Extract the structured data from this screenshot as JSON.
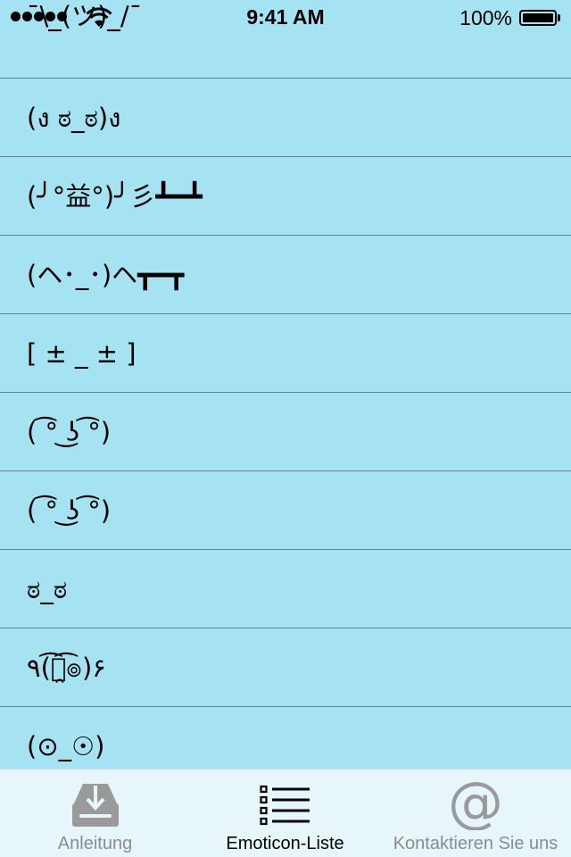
{
  "status_bar": {
    "time": "9:41 AM",
    "battery_percent": "100%",
    "battery_level": 1.0,
    "signal_bars": 5
  },
  "emoticons": [
    "¯\\_(ツ)_/¯",
    "(ง ಠ_ಠ)ง",
    "(╯°益°)╯彡┻━┻",
    "(ヘ･_･)ヘ┳━┳",
    "[ ± _ ± ]",
    "( ͡° ͜ʖ ͡°)",
    "( ͡° ͜ʖ ͡°)",
    "ಠ_ಠ",
    "٩(͡๏̯͡๏)۶",
    "(⊙_☉)"
  ],
  "tab_bar": {
    "tabs": [
      {
        "label": "Anleitung",
        "icon": "download-tray-icon",
        "active": false
      },
      {
        "label": "Emoticon-Liste",
        "icon": "list-icon",
        "active": true
      },
      {
        "label": "Kontaktieren Sie uns",
        "icon": "at-sign-icon",
        "active": false
      }
    ],
    "active_color": "#000000",
    "inactive_color": "#8c8c8c"
  },
  "colors": {
    "background": "#a6e3f2",
    "separator": "#6f7f85",
    "tab_bar_background": "#e6f6fb"
  }
}
